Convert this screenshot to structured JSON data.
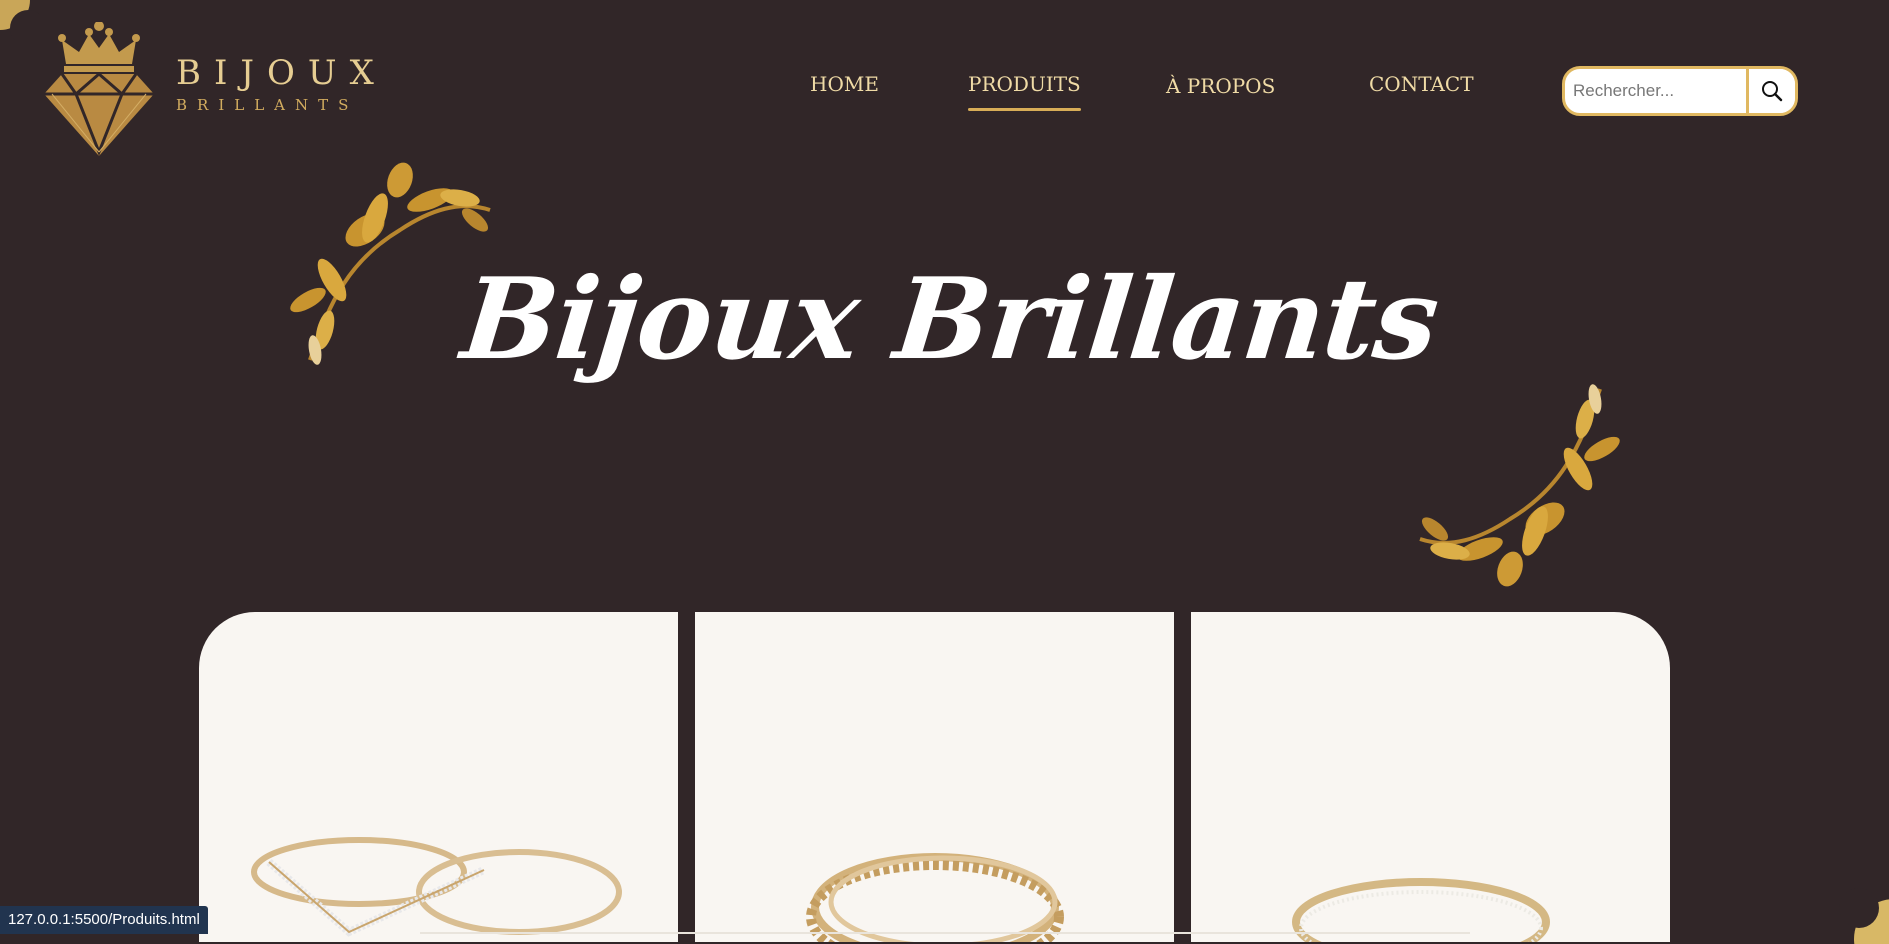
{
  "logo": {
    "line1": "BIJOUX",
    "line2": "BRILLANTS"
  },
  "nav": {
    "items": [
      {
        "label": "HOME",
        "active": false
      },
      {
        "label": "PRODUITS",
        "active": true
      },
      {
        "label": "À PROPOS",
        "active": false
      },
      {
        "label": "CONTACT",
        "active": false
      }
    ]
  },
  "search": {
    "placeholder": "Rechercher...",
    "value": "",
    "icon": "search-icon"
  },
  "hero": {
    "title": "Bijoux Brillants"
  },
  "products": [
    {
      "image": "gold-rings-with-diamond-chevron"
    },
    {
      "image": "stacked-gold-twisted-rings"
    },
    {
      "image": "gold-band-with-diamonds"
    }
  ],
  "status_bar": {
    "url": "127.0.0.1:5500/Produits.html"
  },
  "colors": {
    "background": "#312628",
    "gold": "#d8ad57",
    "nav_text": "#f0dba6",
    "card": "#f9f6f2",
    "status_bar": "#21344f"
  }
}
